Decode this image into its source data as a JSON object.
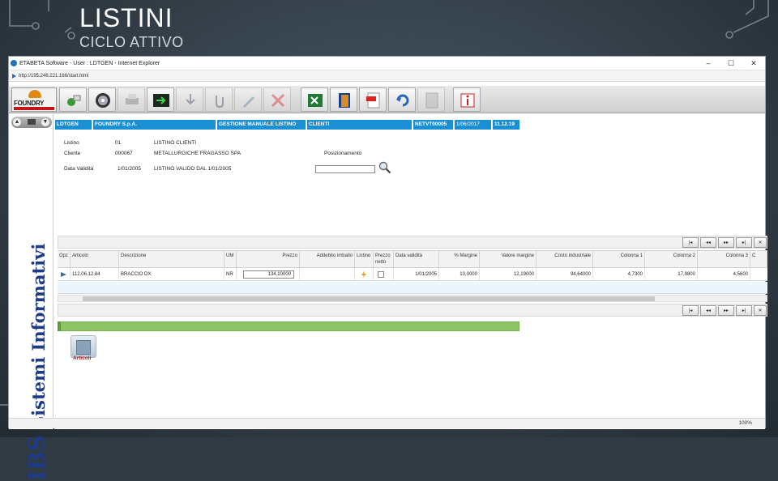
{
  "slide": {
    "title": "LISTINI",
    "subtitle": "CICLO ATTIVO"
  },
  "browser": {
    "window_title": "ETABETA Software - User : LDTGEN - Internet Explorer",
    "url": "http://195.246.221.166/start.html",
    "zoom": "100%",
    "controls": [
      "–",
      "☐",
      "✕"
    ]
  },
  "toolbar": {
    "logo_text": "FOUNDRY",
    "buttons": [
      {
        "name": "connect-icon",
        "enabled": true
      },
      {
        "name": "disc-icon",
        "enabled": true
      },
      {
        "name": "print-icon",
        "enabled": false
      },
      {
        "name": "exit-icon",
        "enabled": true
      },
      {
        "name": "download-icon",
        "enabled": false
      },
      {
        "name": "attach-icon",
        "enabled": false
      },
      {
        "name": "pen-icon",
        "enabled": false
      },
      {
        "name": "delete-icon",
        "enabled": false
      },
      {
        "name": "excel-icon",
        "enabled": true
      },
      {
        "name": "door-icon",
        "enabled": true
      },
      {
        "name": "pdf-icon",
        "enabled": true
      },
      {
        "name": "refresh-icon",
        "enabled": true
      },
      {
        "name": "calculator-icon",
        "enabled": false
      },
      {
        "name": "info-icon",
        "enabled": true
      }
    ]
  },
  "left_rail": {
    "brand": "IBS",
    "tagline": "Sistemi Informativi"
  },
  "header": {
    "user": "LDTGEN",
    "company": "FOUNDRY S.p.A.",
    "function": "GESTIONE MANUALE LISTINO",
    "section": "CLIENTI",
    "terminal": "NETVT00005",
    "date": "1/06/2017",
    "time": "11.12.19"
  },
  "info": {
    "listino_label": "Listino",
    "listino_code": "01",
    "listino_desc": "LISTINO CLIENTI",
    "cliente_label": "Cliente",
    "cliente_code": "000067",
    "cliente_desc": "METALLURGICHE FRAGASSO SPA",
    "validita_label": "Data Validità",
    "validita_date": "1/01/2005",
    "validita_desc": "LISTINO VALIDO DAL 1/01/2005",
    "posizionamento_label": "Posizionamento",
    "posizionamento_value": ""
  },
  "pager": {
    "first": "|◂",
    "prev": "◂◂",
    "next": "▸▸",
    "last": "▸|",
    "close": "✕"
  },
  "grid": {
    "columns": [
      "Opz",
      "Articolo",
      "Descrizione",
      "UM",
      "Prezzo",
      "Addebito imballo",
      "Listino",
      "Prezzo netto",
      "Data validità",
      "% Margine",
      "Valore margine",
      "Costo industriale",
      "Colonna 1",
      "Colonna 2",
      "Colonna 3",
      "C"
    ],
    "row": {
      "articolo": "112.06.12.84",
      "descrizione": "BRACCIO DX",
      "um": "NR",
      "prezzo": "134,10000",
      "addebito": "",
      "data_validita": "1/01/2005",
      "margine_pct": "10,0000",
      "valore_margine": "12,19000",
      "costo_industriale": "94,64000",
      "colonna1": "4,7300",
      "colonna2": "17,9800",
      "colonna3": "4,5600"
    }
  },
  "articoli": {
    "label": "Articoli"
  }
}
